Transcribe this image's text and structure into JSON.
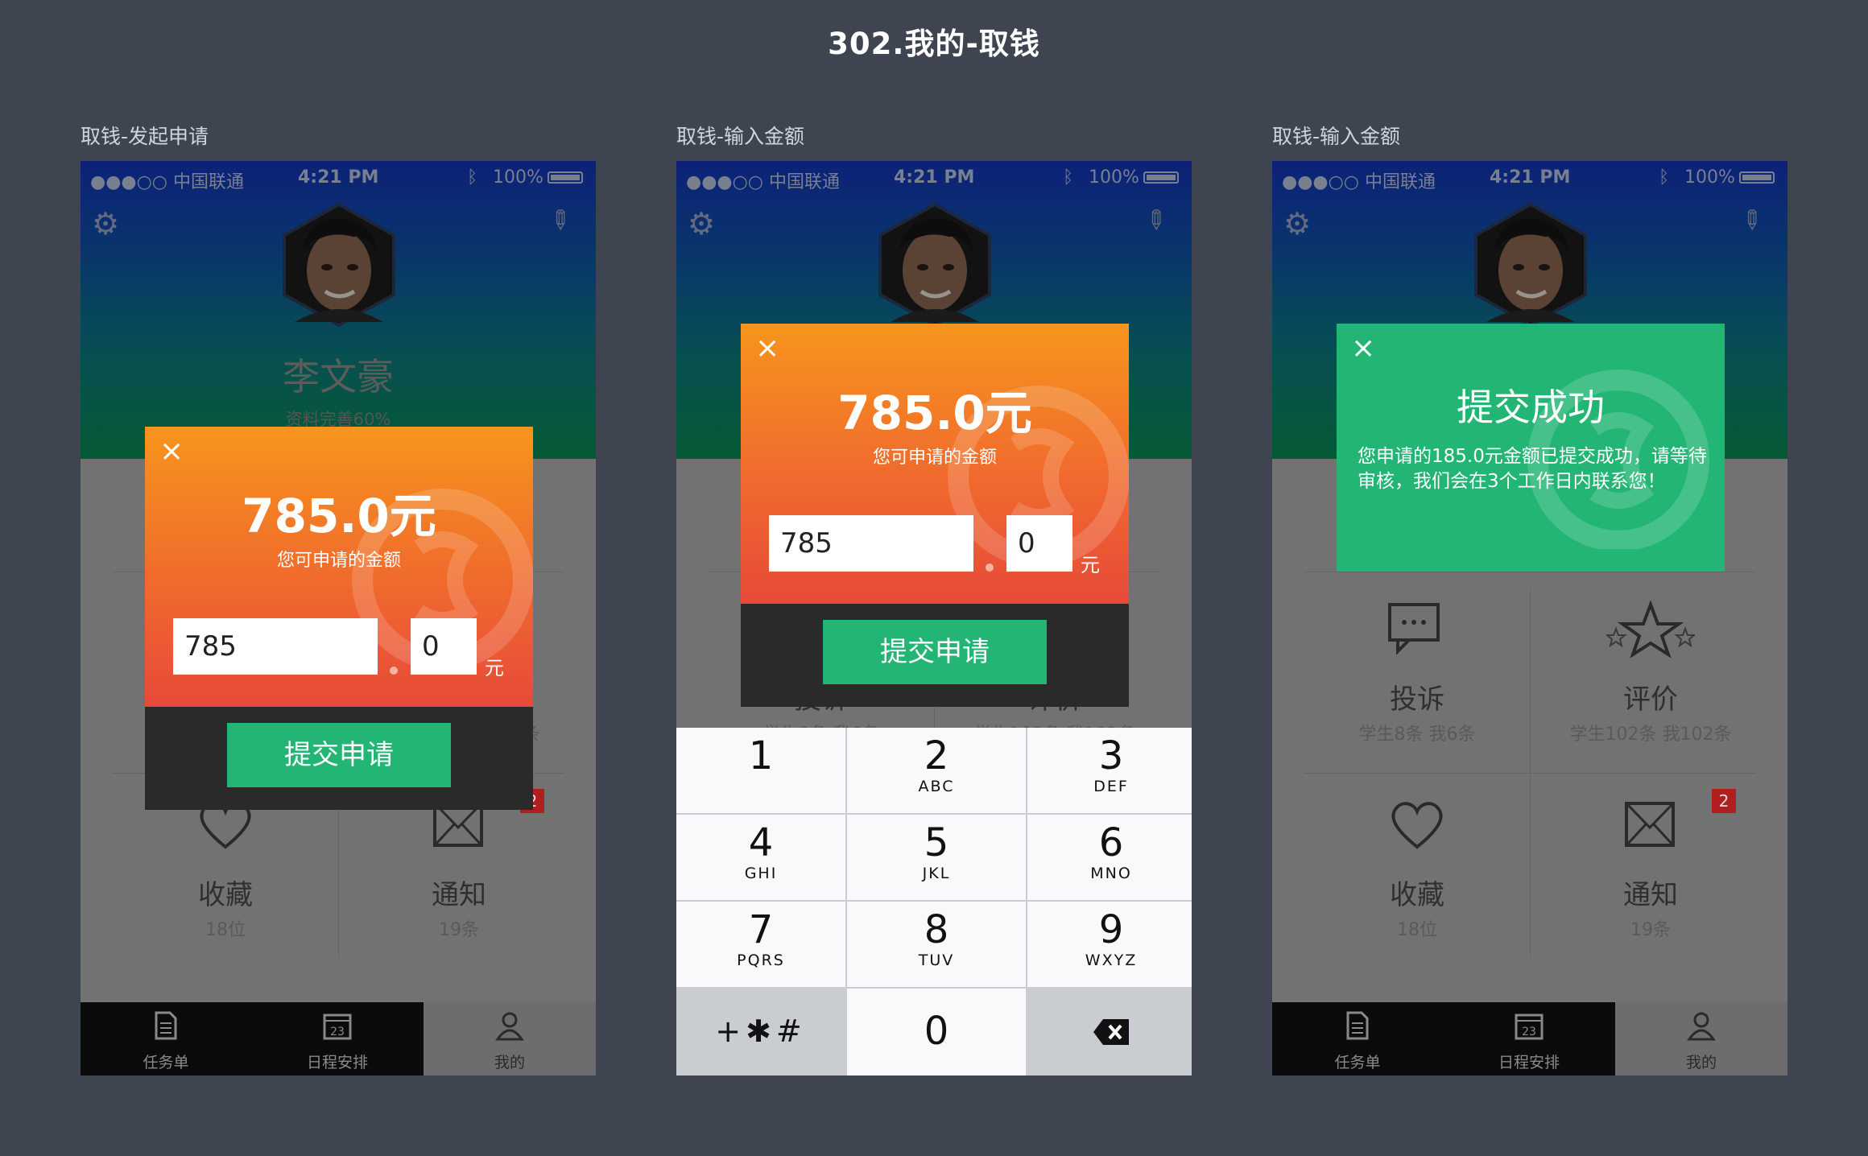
{
  "page_title": "302.我的-取钱",
  "status_bar": {
    "carrier": "●●●○○ 中国联通",
    "time": "4:21 PM",
    "battery": "100%"
  },
  "profile": {
    "name": "李文豪",
    "completeness": "资料完善60%"
  },
  "grid": {
    "complaint": {
      "label": "投诉",
      "sub": "学生8条 我6条"
    },
    "review": {
      "label": "评价",
      "sub": "学生102条 我102条"
    },
    "favorite": {
      "label": "收藏",
      "sub": "18位"
    },
    "notice": {
      "label": "通知",
      "sub": "19条",
      "badge": "2"
    }
  },
  "tabs": [
    {
      "label": "任务单",
      "icon": "document-icon"
    },
    {
      "label": "日程安排",
      "icon": "calendar-icon",
      "day": "23"
    },
    {
      "label": "我的",
      "icon": "person-icon"
    }
  ],
  "screens": [
    {
      "caption": "取钱-发起申请"
    },
    {
      "caption": "取钱-输入金额"
    },
    {
      "caption": "取钱-输入金额"
    }
  ],
  "withdraw": {
    "amount": "785.0元",
    "amount_label": "您可申请的金额",
    "integer_value": "785",
    "decimal_value": "0",
    "unit": "元",
    "submit_label": "提交申请",
    "close_symbol": "×"
  },
  "success": {
    "title": "提交成功",
    "message": "您申请的185.0元金额已提交成功，请等待审核，我们会在3个工作日内联系您！"
  },
  "keypad": {
    "keys": [
      {
        "digit": "1",
        "letters": ""
      },
      {
        "digit": "2",
        "letters": "ABC"
      },
      {
        "digit": "3",
        "letters": "DEF"
      },
      {
        "digit": "4",
        "letters": "GHI"
      },
      {
        "digit": "5",
        "letters": "JKL"
      },
      {
        "digit": "6",
        "letters": "MNO"
      },
      {
        "digit": "7",
        "letters": "PQRS"
      },
      {
        "digit": "8",
        "letters": "TUV"
      },
      {
        "digit": "9",
        "letters": "WXYZ"
      }
    ],
    "symbols": "+✱#",
    "zero": "0"
  },
  "colors": {
    "accent_green": "#22b573",
    "orange_top": "#f7951d",
    "red_bottom": "#e74a3a",
    "badge_red": "#b01e1e"
  }
}
